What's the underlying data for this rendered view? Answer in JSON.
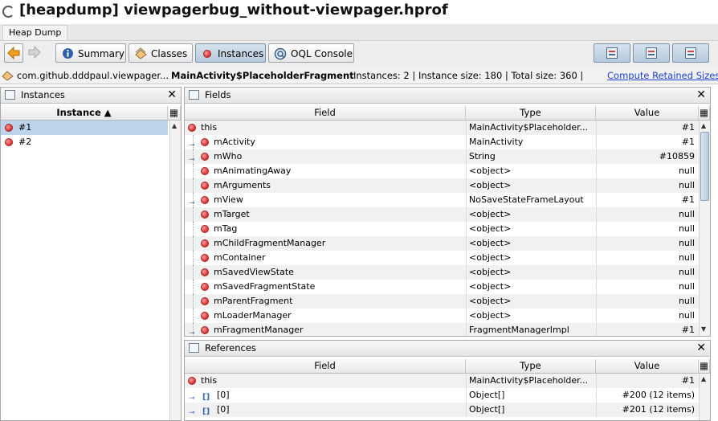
{
  "window": {
    "title": "[heapdump] viewpagerbug_without-viewpager.hprof"
  },
  "tab": {
    "label": "Heap Dump"
  },
  "toolbar": {
    "back_icon": "arrow-left-icon",
    "forward_icon": "arrow-right-icon",
    "buttons": [
      {
        "label": "Summary",
        "icon": "info-icon"
      },
      {
        "label": "Classes",
        "icon": "classes-icon"
      },
      {
        "label": "Instances",
        "icon": "instance-icon"
      },
      {
        "label": "OQL Console",
        "icon": "oql-icon"
      }
    ],
    "right_buttons": [
      "show-instances-icon",
      "show-fields-icon",
      "show-references-icon"
    ]
  },
  "infobar": {
    "package": "com.github.dddpaul.viewpager...",
    "class_name": "MainActivity$PlaceholderFragment",
    "stats": "Instances: 2  |  Instance size: 180  |  Total size: 360  |",
    "compute_link": "Compute Retained Sizes"
  },
  "instances_panel": {
    "title": "Instances",
    "column": "Instance ▲",
    "rows": [
      "#1",
      "#2"
    ]
  },
  "fields_panel": {
    "title": "Fields",
    "columns": {
      "field": "Field",
      "type": "Type",
      "value": "Value"
    },
    "rows": [
      {
        "name": "this",
        "type": "MainActivity$Placeholder...",
        "value": "#1",
        "level": 0,
        "expand": false
      },
      {
        "name": "mActivity",
        "type": "MainActivity",
        "value": "#1",
        "level": 1,
        "expand": true
      },
      {
        "name": "mWho",
        "type": "String",
        "value": "#10859",
        "level": 1,
        "expand": true
      },
      {
        "name": "mAnimatingAway",
        "type": "<object>",
        "value": "null",
        "level": 1,
        "expand": false
      },
      {
        "name": "mArguments",
        "type": "<object>",
        "value": "null",
        "level": 1,
        "expand": false
      },
      {
        "name": "mView",
        "type": "NoSaveStateFrameLayout",
        "value": "#1",
        "level": 1,
        "expand": true
      },
      {
        "name": "mTarget",
        "type": "<object>",
        "value": "null",
        "level": 1,
        "expand": false
      },
      {
        "name": "mTag",
        "type": "<object>",
        "value": "null",
        "level": 1,
        "expand": false
      },
      {
        "name": "mChildFragmentManager",
        "type": "<object>",
        "value": "null",
        "level": 1,
        "expand": false
      },
      {
        "name": "mContainer",
        "type": "<object>",
        "value": "null",
        "level": 1,
        "expand": false
      },
      {
        "name": "mSavedViewState",
        "type": "<object>",
        "value": "null",
        "level": 1,
        "expand": false
      },
      {
        "name": "mSavedFragmentState",
        "type": "<object>",
        "value": "null",
        "level": 1,
        "expand": false
      },
      {
        "name": "mParentFragment",
        "type": "<object>",
        "value": "null",
        "level": 1,
        "expand": false
      },
      {
        "name": "mLoaderManager",
        "type": "<object>",
        "value": "null",
        "level": 1,
        "expand": false
      },
      {
        "name": "mFragmentManager",
        "type": "FragmentManagerImpl",
        "value": "#1",
        "level": 1,
        "expand": true
      }
    ]
  },
  "references_panel": {
    "title": "References",
    "columns": {
      "field": "Field",
      "type": "Type",
      "value": "Value"
    },
    "rows": [
      {
        "name": "this",
        "type": "MainActivity$Placeholder...",
        "value": "#1",
        "kind": "object"
      },
      {
        "name": "[0]",
        "type": "Object[]",
        "value": "#200 (12 items)",
        "kind": "array"
      },
      {
        "name": "[0]",
        "type": "Object[]",
        "value": "#201 (12 items)",
        "kind": "array"
      }
    ]
  }
}
